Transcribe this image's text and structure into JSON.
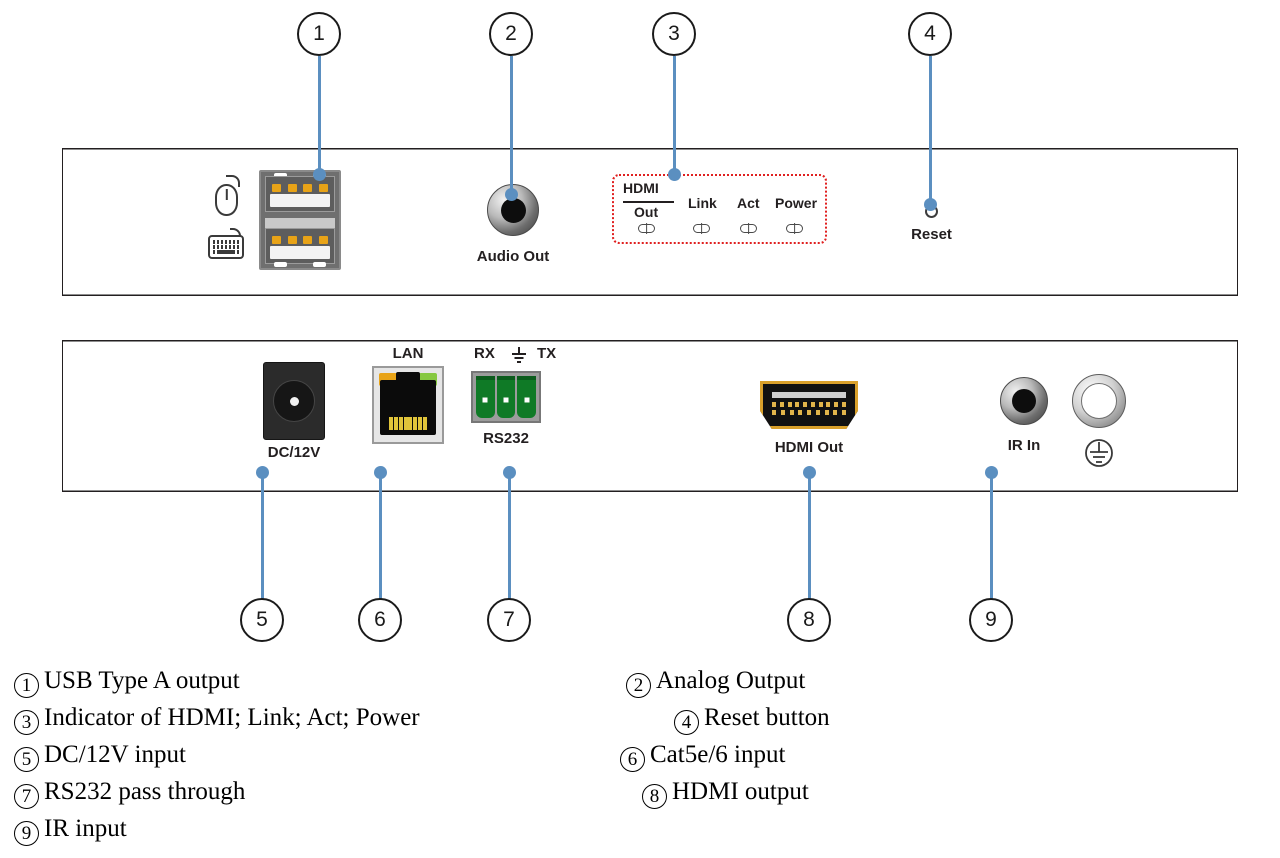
{
  "diagram": {
    "title": "Device front and rear panel callout diagram",
    "accent_color": "#5b8fc0",
    "indicator_box_color": "#e02020"
  },
  "callouts": [
    {
      "id": "1",
      "label": "1"
    },
    {
      "id": "2",
      "label": "2"
    },
    {
      "id": "3",
      "label": "3"
    },
    {
      "id": "4",
      "label": "4"
    },
    {
      "id": "5",
      "label": "5"
    },
    {
      "id": "6",
      "label": "6"
    },
    {
      "id": "7",
      "label": "7"
    },
    {
      "id": "8",
      "label": "8"
    },
    {
      "id": "9",
      "label": "9"
    }
  ],
  "front_panel": {
    "usb": {
      "peripheral_icons": [
        "mouse-icon",
        "keyboard-icon"
      ]
    },
    "audio": {
      "label": "Audio Out"
    },
    "indicators": {
      "hdmi_label": "HDMI",
      "out_label": "Out",
      "items": [
        {
          "label": "Out"
        },
        {
          "label": "Link"
        },
        {
          "label": "Act"
        },
        {
          "label": "Power"
        }
      ]
    },
    "reset": {
      "label": "Reset"
    }
  },
  "rear_panel": {
    "dc": {
      "label": "DC/12V"
    },
    "lan": {
      "label": "LAN"
    },
    "rs232": {
      "label": "RS232",
      "rx_label": "RX",
      "tx_label": "TX",
      "ground_symbol": "ground-icon"
    },
    "hdmi_out": {
      "label": "HDMI Out"
    },
    "ir_in": {
      "label": "IR In"
    },
    "ground": {
      "symbol": "earth-ground-icon"
    }
  },
  "legend": {
    "left_column": [
      {
        "num": "1",
        "text": "USB Type A output"
      },
      {
        "num": "3",
        "text": "Indicator of HDMI; Link; Act; Power"
      },
      {
        "num": "5",
        "text": "DC/12V input"
      },
      {
        "num": "7",
        "text": "RS232 pass through"
      },
      {
        "num": "9",
        "text": "IR input"
      }
    ],
    "right_column": [
      {
        "num": "2",
        "text": "Analog Output"
      },
      {
        "num": "4",
        "text": "Reset button"
      },
      {
        "num": "6",
        "text": "Cat5e/6 input"
      },
      {
        "num": "8",
        "text": "HDMI output"
      }
    ]
  }
}
